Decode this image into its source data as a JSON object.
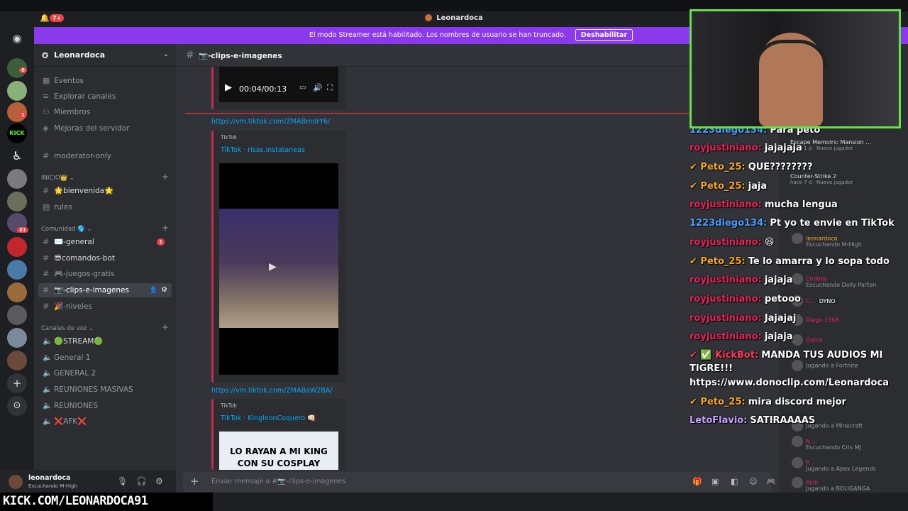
{
  "window": {
    "title": "Leonardoca",
    "notif_count": "7+"
  },
  "banner": {
    "text": "El modo Streamer está habilitado. Los nombres de usuario se han truncado.",
    "button": "Deshabilitar"
  },
  "rail": {
    "badges": [
      "6",
      "1",
      "21"
    ]
  },
  "guild": {
    "name": "Leonardoca"
  },
  "channels": {
    "top": [
      "Eventos",
      "Explorar canales",
      "Miembros",
      "Mejoras del servidor"
    ],
    "moderator": "moderator-only",
    "cat1": "INICIO👑",
    "inicio": [
      "🌟bienvenida🌟",
      "rules"
    ],
    "cat2": "Comunidad 🌎",
    "comunidad": [
      "✉️-general",
      "😎comandos-bot",
      "🎮-juegos-gratis",
      "📷-clips-e-imagenes",
      "🎉-niveles"
    ],
    "general_badge": "1",
    "cat3": "Canales de voz",
    "voz": [
      "🟢STREAM🟢",
      "General 1",
      "GENERAL 2",
      "REUNIONES MASIVAS",
      "REUNIONES",
      "❌AFK❌"
    ]
  },
  "user": {
    "name": "leonardoca",
    "status": "Escuchando M-High"
  },
  "kick_url": "KICK.COM/LEONARDOCA91",
  "chat": {
    "channel": "📷-clips-e-imagenes",
    "video_time": "00:04/00:13",
    "link1": "https://vm.tiktok.com/ZMABmdrY6/",
    "provider1": "TikTok",
    "title1": "TikTok · risas.instataneas",
    "link2": "https://vm.tiktok.com/ZMABaW2BA/",
    "provider2": "TikTok",
    "title2": "TikTok · KingleonCoquero 👊🏻",
    "thumb2_text": "LO RAYAN A MI KING CON SU COSPLAY",
    "composer_placeholder": "Enviar mensaje a #📷-clips-e-imagenes"
  },
  "stream_chat": [
    {
      "user": "1223diego134:",
      "text": "Para peto",
      "color": "blu"
    },
    {
      "user": "royjustiniano:",
      "text": "jajajaja",
      "color": "red"
    },
    {
      "user": "✔ Peto_25:",
      "text": "QUE????????",
      "color": "org"
    },
    {
      "user": "✔ Peto_25:",
      "text": "jaja",
      "color": "org"
    },
    {
      "user": "royjustiniano:",
      "text": "mucha lengua",
      "color": "red"
    },
    {
      "user": "1223diego134:",
      "text": "Pt yo te envie en TikTok",
      "color": "blu"
    },
    {
      "user": "royjustiniano:",
      "text": "😆",
      "color": "red"
    },
    {
      "user": "✔ Peto_25:",
      "text": "Te lo amarra y lo sopa todo",
      "color": "org"
    },
    {
      "user": "royjustiniano:",
      "text": "jajaja",
      "color": "red"
    },
    {
      "user": "royjustiniano:",
      "text": "petooo",
      "color": "red"
    },
    {
      "user": "royjustiniano:",
      "text": "Jajajaj",
      "color": "red"
    },
    {
      "user": "royjustiniano:",
      "text": "jajaja",
      "color": "red"
    },
    {
      "user": "✔ ✅ KickBot:",
      "text": "MANDA TUS AUDIOS MI",
      "color": "kb"
    },
    {
      "user": "",
      "text": "TIGRE!!!",
      "color": ""
    },
    {
      "user": "",
      "text": "https://www.donoclip.com/Leonardoca",
      "color": ""
    },
    {
      "user": "✔ Peto_25:",
      "text": "mira discord mejor",
      "color": "org"
    },
    {
      "user": "LetoFlavio:",
      "text": "SATIRAAAAS",
      "color": "pur"
    }
  ],
  "members": [
    {
      "name": "Escape Memoirs: Mansion ...",
      "sub": "hace 1 d · Nuevo jugador"
    },
    {
      "name": "Counter-Strike 2",
      "sub": "hace 7 d · Nuevo jugador"
    },
    {
      "name": "leonardoca",
      "sub": "Escuchando M-High"
    },
    {
      "name": "Chobby",
      "sub": "Escuchando Dolly Parton"
    },
    {
      "name": "C...",
      "sub": "DYNO"
    },
    {
      "name": "Diego 1568",
      "sub": ""
    },
    {
      "name": "Gatox",
      "sub": ""
    },
    {
      "name": "",
      "sub": "Jugando a Fortnite"
    },
    {
      "name": "",
      "sub": "Jugando a Minecraft"
    },
    {
      "name": "N...",
      "sub": "Escuchando Cris MJ"
    },
    {
      "name": "P...",
      "sub": "Jugando a Apex Legends"
    },
    {
      "name": "Rich",
      "sub": "Jugando a BOLIGANGA"
    }
  ]
}
